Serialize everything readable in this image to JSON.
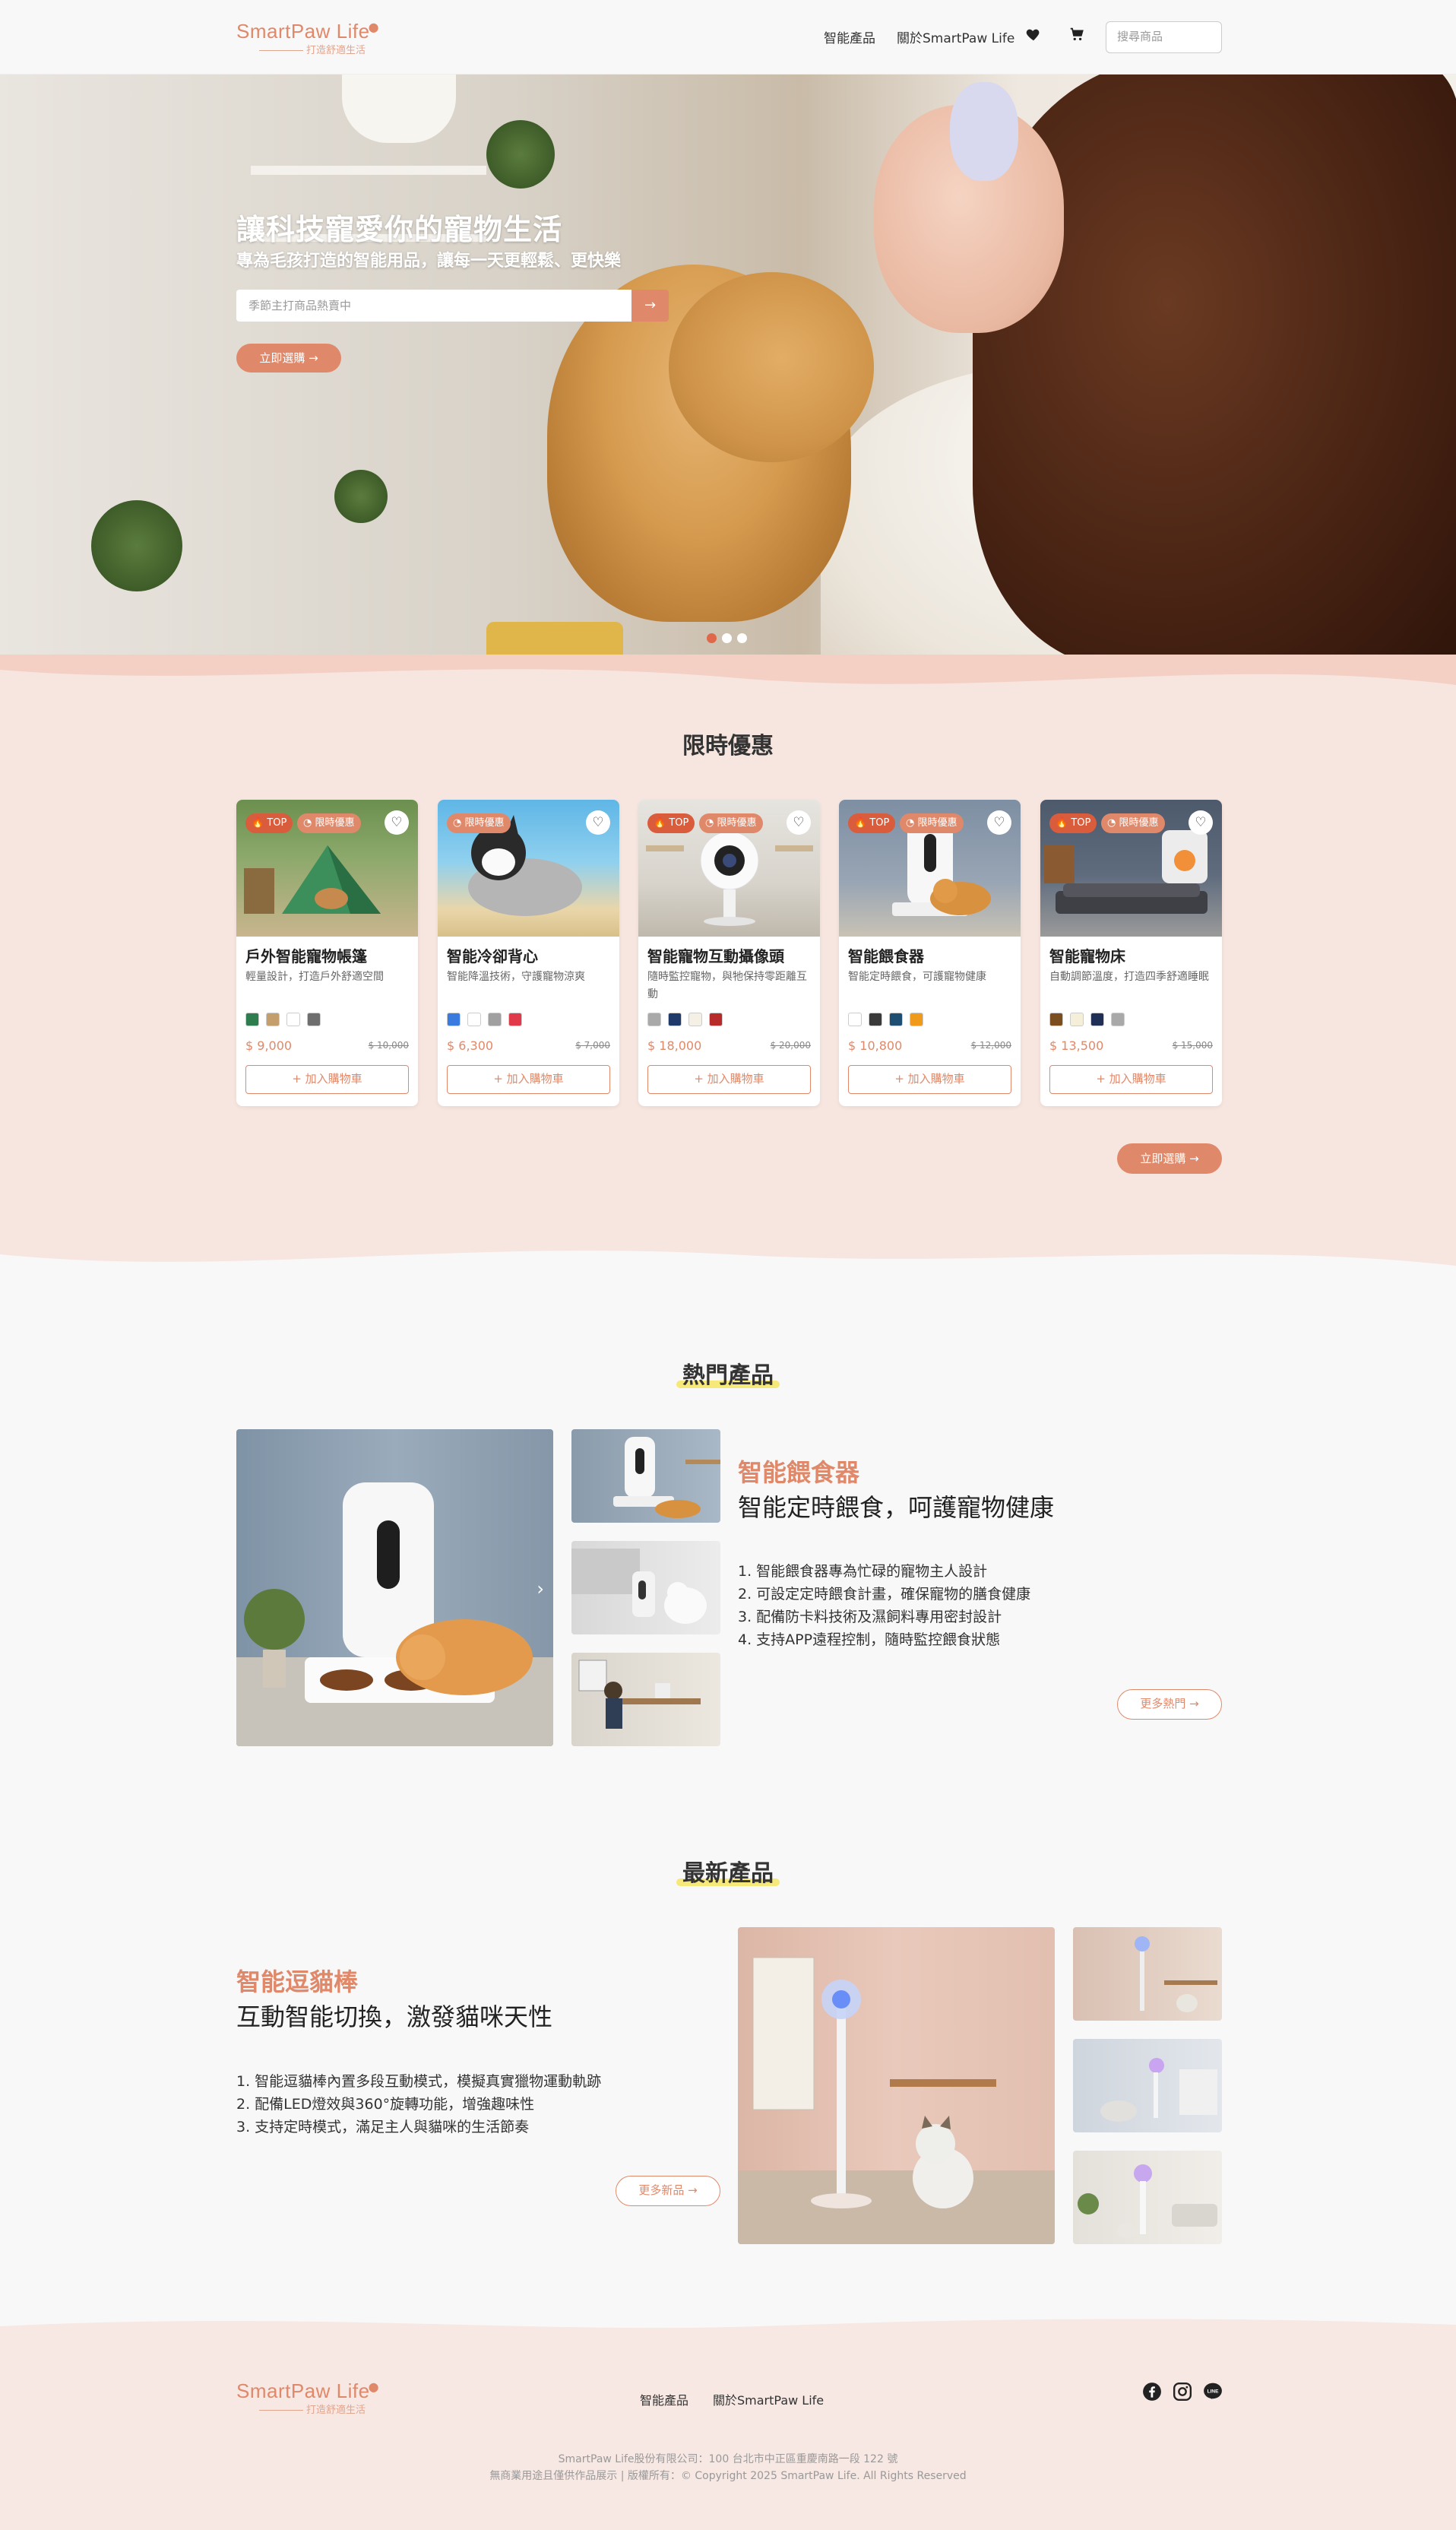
{
  "brand": {
    "name": "SmartPaw Life",
    "tagline": "打造舒適生活"
  },
  "nav": {
    "products": "智能產品",
    "about": "關於SmartPaw Life",
    "search_placeholder": "搜尋商品"
  },
  "hero": {
    "title": "讓科技寵愛你的寵物生活",
    "subtitle": "專為毛孩打造的智能用品，讓每一天更輕鬆、更快樂",
    "search_placeholder": "季節主打商品熱賣中",
    "cta": "立即選購"
  },
  "sale": {
    "title": "限時優惠",
    "cta": "立即選購",
    "badge_top": "TOP",
    "badge_sale": "限時優惠",
    "add_cart": "加入購物車",
    "items": [
      {
        "name": "戶外智能寵物帳篷",
        "desc": "輕量設計，打造戶外舒適空間",
        "price": "$ 9,000",
        "old_price": "$ 10,000",
        "top": true,
        "colors": [
          "#2e7d4f",
          "#c59e6e",
          "#ffffff",
          "#6e6e6e"
        ]
      },
      {
        "name": "智能冷卻背心",
        "desc": "智能降溫技術，守護寵物涼爽",
        "price": "$ 6,300",
        "old_price": "$ 7,000",
        "top": false,
        "colors": [
          "#3a7be0",
          "#ffffff",
          "#a0a0a0",
          "#e0394a"
        ]
      },
      {
        "name": "智能寵物互動攝像頭",
        "desc": "隨時監控寵物，與牠保持零距離互動",
        "price": "$ 18,000",
        "old_price": "$ 20,000",
        "top": true,
        "colors": [
          "#a9a9a9",
          "#1f3a6a",
          "#f5f0e6",
          "#b62a2a"
        ]
      },
      {
        "name": "智能餵食器",
        "desc": "智能定時餵食，可護寵物健康",
        "price": "$ 10,800",
        "old_price": "$ 12,000",
        "top": true,
        "colors": [
          "#ffffff",
          "#3a3a3a",
          "#1f4e73",
          "#f09a1c"
        ]
      },
      {
        "name": "智能寵物床",
        "desc": "自動調節溫度，打造四季舒適睡眠",
        "price": "$ 13,500",
        "old_price": "$ 15,000",
        "top": true,
        "colors": [
          "#7a4e1e",
          "#f5efd9",
          "#1f2f55",
          "#a9a9a9"
        ]
      }
    ]
  },
  "hot": {
    "title": "熱門產品",
    "product_title": "智能餵食器",
    "product_sub": "智能定時餵食，呵護寵物健康",
    "features": [
      "1. 智能餵食器專為忙碌的寵物主人設計",
      "2. 可設定定時餵食計畫，確保寵物的膳食健康",
      "3. 配備防卡料技術及濕飼料專用密封設計",
      "4. 支持APP遠程控制，隨時監控餵食狀態"
    ],
    "more": "更多熱門"
  },
  "new": {
    "title": "最新產品",
    "product_title": "智能逗貓棒",
    "product_sub": "互動智能切換，激發貓咪天性",
    "features": [
      "1. 智能逗貓棒內置多段互動模式，模擬真實獵物運動軌跡",
      "2. 配備LED燈效與360°旋轉功能，增強趣味性",
      "3. 支持定時模式，滿足主人與貓咪的生活節奏"
    ],
    "more": "更多新品"
  },
  "footer": {
    "links": [
      "智能產品",
      "關於SmartPaw Life"
    ],
    "address": "SmartPaw Life股份有限公司：100 台北市中正區重慶南路一段 122 號",
    "copyright": "無商業用途且僅供作品展示 | 版權所有：© Copyright 2025 SmartPaw Life. All Rights Reserved",
    "social": [
      "facebook-icon",
      "instagram-icon",
      "line-icon"
    ]
  },
  "colors": {
    "accent": "#e0896a",
    "badge_top": "#d95c3c",
    "sale_bg": "#f7e5df",
    "highlight": "#f5e76a"
  }
}
